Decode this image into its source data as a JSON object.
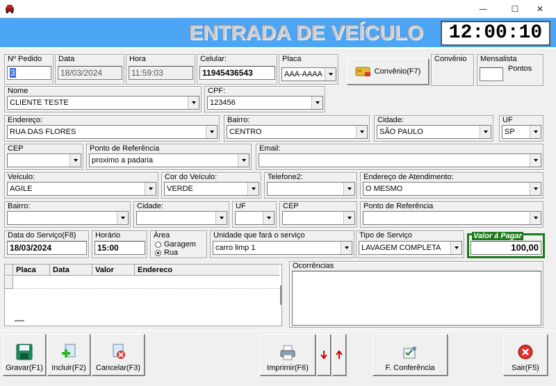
{
  "window": {
    "minimize": "—",
    "maximize": "☐",
    "close": "✕"
  },
  "header": {
    "title": "ENTRADA DE VEÍCULO",
    "clock": "12:00:10"
  },
  "row1": {
    "pedido_label": "Nº Pedido",
    "pedido": "3",
    "data_label": "Data",
    "data": "18/03/2024",
    "hora_label": "Hora",
    "hora": "11:59:03",
    "celular_label": "Celular:",
    "celular": "11945436543",
    "placa_label": "Placa",
    "placa": "AAA-AAAA",
    "convenio_button": "Convênio(F7)",
    "convenio_label": "Convênio",
    "mensalista_label": "Mensalista",
    "pontos_label": "Pontos"
  },
  "row2": {
    "nome_label": "Nome",
    "nome": "CLIENTE TESTE",
    "cpf_label": "CPF:",
    "cpf": "123456"
  },
  "row3": {
    "endereco_label": "Endereço:",
    "endereco": "RUA DAS FLORES",
    "bairro_label": "Bairro:",
    "bairro": "CENTRO",
    "cidade_label": "Cidade:",
    "cidade": "SÃO PAULO",
    "uf_label": "UF",
    "uf": "SP"
  },
  "row4": {
    "cep_label": "CEP",
    "cep": "",
    "referencia_label": "Ponto de Referência",
    "referencia": "proximo a padaria",
    "email_label": "Email:",
    "email": ""
  },
  "row5": {
    "veiculo_label": "Veículo:",
    "veiculo": "AGILE",
    "cor_label": "Cor do Veículo:",
    "cor": "VERDE",
    "telefone2_label": "Telefone2:",
    "telefone2": "",
    "atendimento_label": "Endereço de Atendimento:",
    "atendimento": "O MESMO"
  },
  "row6": {
    "bairro_label": "Bairro:",
    "cidade_label": "Cidade:",
    "uf_label": "UF",
    "cep_label": "CEP",
    "referencia_label": "Ponto de Referência"
  },
  "row7": {
    "data_servico_label": "Data do Serviço(F8)",
    "data_servico": "18/03/2024",
    "horario_label": "Horário",
    "horario": "15:00",
    "area_label": "Área",
    "area_garagem": "Garagem",
    "area_rua": "Rua",
    "area_selected": "Rua",
    "unidade_label": "Unidade que fará o serviço",
    "unidade": "carro limp 1",
    "tipo_label": "Tipo de Serviço",
    "tipo": "LAVAGEM COMPLETA",
    "valor_label": "Valor á Pagar",
    "valor": "100,00"
  },
  "table": {
    "columns": [
      "Placa",
      "Data",
      "Valor",
      "Endereco"
    ],
    "rows": []
  },
  "ocorrencias_label": "Ocorrências",
  "toolbar": {
    "gravar": "Gravar(F1)",
    "incluir": "Incluir(F2)",
    "cancelar": "Cancelar(F3)",
    "imprimir": "Imprimir(F6)",
    "conferencia": "F. Conferência",
    "sair": "Sair(F5)"
  },
  "colors": {
    "banner": "#4da6f5",
    "valor_border": "#1a7a1a",
    "arrow_red": "#cc0000"
  }
}
